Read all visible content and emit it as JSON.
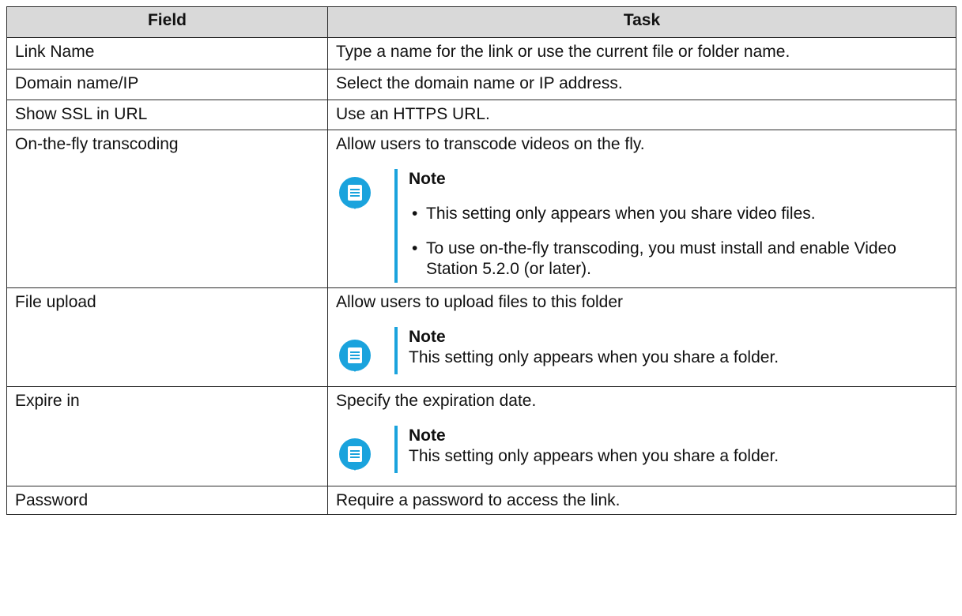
{
  "table": {
    "headers": [
      "Field",
      "Task"
    ],
    "rows": [
      {
        "field": "Link Name",
        "task": "Type a name for the link or use the current file or folder name."
      },
      {
        "field": "Domain name/IP",
        "task": "Select the domain name or IP address."
      },
      {
        "field": "Show SSL in URL",
        "task": "Use an HTTPS URL."
      },
      {
        "field": "On-the-fly transcoding",
        "task": "Allow users to transcode videos on the fly.",
        "note": {
          "title": "Note",
          "items": [
            "This setting only appears when you share video files.",
            "To use on-the-fly transcoding, you must install and enable Video Station 5.2.0 (or later)."
          ]
        }
      },
      {
        "field": "File upload",
        "task": "Allow users to upload files to this folder",
        "note": {
          "title": "Note",
          "text": "This setting only appears when you share a folder."
        }
      },
      {
        "field": "Expire in",
        "task": "Specify the expiration date.",
        "note": {
          "title": "Note",
          "text": "This setting only appears when you share a folder."
        }
      },
      {
        "field": "Password",
        "task": "Require a password to access the link."
      }
    ]
  },
  "bullet": "•",
  "colors": {
    "accent": "#1aa3dd",
    "header_bg": "#d9d9d9"
  },
  "icon": "note-icon"
}
